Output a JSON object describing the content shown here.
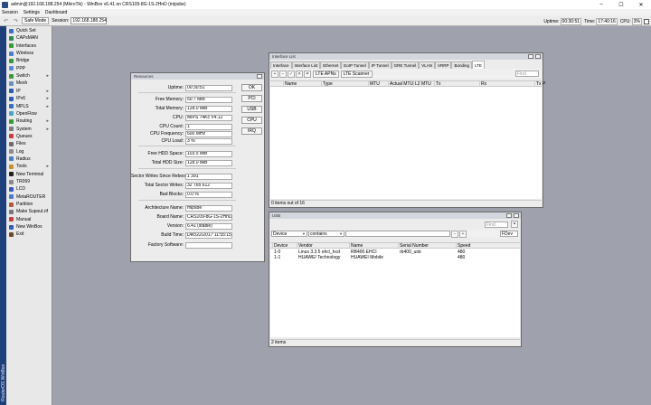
{
  "window": {
    "title": "admin@192.168.188.254 (MikroTik) - WinBox v6.41 on CRS109-8G-1S-2HnD (mipsbe)",
    "controls": [
      "–",
      "☐",
      "✕"
    ]
  },
  "menu": [
    "Session",
    "Settings",
    "Dashboard"
  ],
  "toolbar": {
    "safe_mode": "Safe Mode",
    "session_label": "Session:",
    "session_value": "192.168.188.254",
    "uptime_label": "Uptime:",
    "uptime_value": "00:30:51",
    "time_label": "Time:",
    "time_value": "17:40:16",
    "cpu_label": "CPU:",
    "cpu_value": "3%"
  },
  "sidebar": {
    "brand": "RouterOS WinBox",
    "items": [
      {
        "label": "Quick Set",
        "color": "#3c6fc4",
        "arrow": ""
      },
      {
        "label": "CAPsMAN",
        "color": "#2d8a52",
        "arrow": ""
      },
      {
        "label": "Interfaces",
        "color": "#3a9a3a",
        "arrow": ""
      },
      {
        "label": "Wireless",
        "color": "#4e7fc8",
        "arrow": ""
      },
      {
        "label": "Bridge",
        "color": "#3a9a3a",
        "arrow": ""
      },
      {
        "label": "PPP",
        "color": "#5a8ad6",
        "arrow": ""
      },
      {
        "label": "Switch",
        "color": "#3a9a3a",
        "arrow": "▸"
      },
      {
        "label": "Mesh",
        "color": "#6c8fc0",
        "arrow": ""
      },
      {
        "label": "IP",
        "color": "#2d5fb0",
        "arrow": "▸"
      },
      {
        "label": "IPv6",
        "color": "#2d5fb0",
        "arrow": "▸"
      },
      {
        "label": "MPLS",
        "color": "#3a6fc0",
        "arrow": "▸"
      },
      {
        "label": "OpenFlow",
        "color": "#4aa3c8",
        "arrow": ""
      },
      {
        "label": "Routing",
        "color": "#3a9a3a",
        "arrow": "▸"
      },
      {
        "label": "System",
        "color": "#7d7d7d",
        "arrow": "▸"
      },
      {
        "label": "Queues",
        "color": "#c83c3c",
        "arrow": ""
      },
      {
        "label": "Files",
        "color": "#6c6c6c",
        "arrow": ""
      },
      {
        "label": "Log",
        "color": "#8c8c8c",
        "arrow": ""
      },
      {
        "label": "Radius",
        "color": "#4a7ec8",
        "arrow": ""
      },
      {
        "label": "Tools",
        "color": "#c8902a",
        "arrow": "▸"
      },
      {
        "label": "New Terminal",
        "color": "#222222",
        "arrow": ""
      },
      {
        "label": "TR069",
        "color": "#8a8a8a",
        "arrow": ""
      },
      {
        "label": "LCD",
        "color": "#3a5ac0",
        "arrow": ""
      },
      {
        "label": "MetaROUTER",
        "color": "#4a7ec8",
        "arrow": ""
      },
      {
        "label": "Partition",
        "color": "#b05a3a",
        "arrow": ""
      },
      {
        "label": "Make Supout.rif",
        "color": "#7a7a7a",
        "arrow": ""
      },
      {
        "label": "Manual",
        "color": "#c83c3c",
        "arrow": ""
      },
      {
        "label": "New WinBox",
        "color": "#2d5fb0",
        "arrow": ""
      },
      {
        "label": "Exit",
        "color": "#6a4a2a",
        "arrow": ""
      }
    ]
  },
  "resources": {
    "title": "Resources",
    "rows": [
      {
        "label": "Uptime:",
        "value": "00:30:51"
      },
      {
        "label": "Free Memory:",
        "value": "50.7 MiB"
      },
      {
        "label": "Total Memory:",
        "value": "128.0 MiB"
      },
      {
        "label": "CPU:",
        "value": "MIPS 74Kc V4.12"
      },
      {
        "label": "CPU Count:",
        "value": "1"
      },
      {
        "label": "CPU Frequency:",
        "value": "600 MHz"
      },
      {
        "label": "CPU Load:",
        "value": "3 %"
      },
      {
        "label": "Free HDD Space:",
        "value": "103.5 MiB"
      },
      {
        "label": "Total HDD Size:",
        "value": "128.0 MiB"
      },
      {
        "label": "Sector Writes Since Reboot:",
        "value": "1 391"
      },
      {
        "label": "Total Sector Writes:",
        "value": "32 765 612"
      },
      {
        "label": "Bad Blocks:",
        "value": "0.0 %"
      },
      {
        "label": "Architecture Name:",
        "value": "mipsbe"
      },
      {
        "label": "Board Name:",
        "value": "CRS109-8G-1S-2HnD"
      },
      {
        "label": "Version:",
        "value": "6.41 (stable)"
      },
      {
        "label": "Build Time:",
        "value": "Dec/22/2017 11:55:15"
      },
      {
        "label": "Factory Software:",
        "value": ""
      }
    ],
    "buttons": [
      "OK",
      "PCI",
      "USB",
      "CPU",
      "IRQ"
    ]
  },
  "interfaces": {
    "title": "Interface List",
    "tabs": [
      "Interface",
      "Interface List",
      "Ethernet",
      "EoIP Tunnel",
      "IP Tunnel",
      "GRE Tunnel",
      "VLAN",
      "VRRP",
      "Bonding",
      "LTE"
    ],
    "active_tab": "LTE",
    "buttons": [
      "LTE APNs",
      "LTE Scanner"
    ],
    "find_placeholder": "Find",
    "columns": [
      "Name",
      "Type",
      "MTU",
      "Actual MTU",
      "L2 MTU",
      "Tx",
      "Rx",
      "Tx P"
    ],
    "status": "0 items out of 16"
  },
  "usb": {
    "title": "USB",
    "filter_field": "Device",
    "filter_op": "contains",
    "filter_scope": "FDev",
    "find_placeholder": "Find",
    "columns": [
      "Device",
      "Vendor",
      "Name",
      "Serial Number",
      "Speed"
    ],
    "rows": [
      {
        "device": "1-0",
        "vendor": "Linux 3.3.5 ehci_hcd",
        "name": "RB400 EHCI",
        "serial": "rb400_usb",
        "speed": "480"
      },
      {
        "device": "1-1",
        "vendor": "HUAWEI Technology",
        "name": "HUAWEI Mobile",
        "serial": "",
        "speed": "480"
      }
    ],
    "status": "2 items"
  }
}
